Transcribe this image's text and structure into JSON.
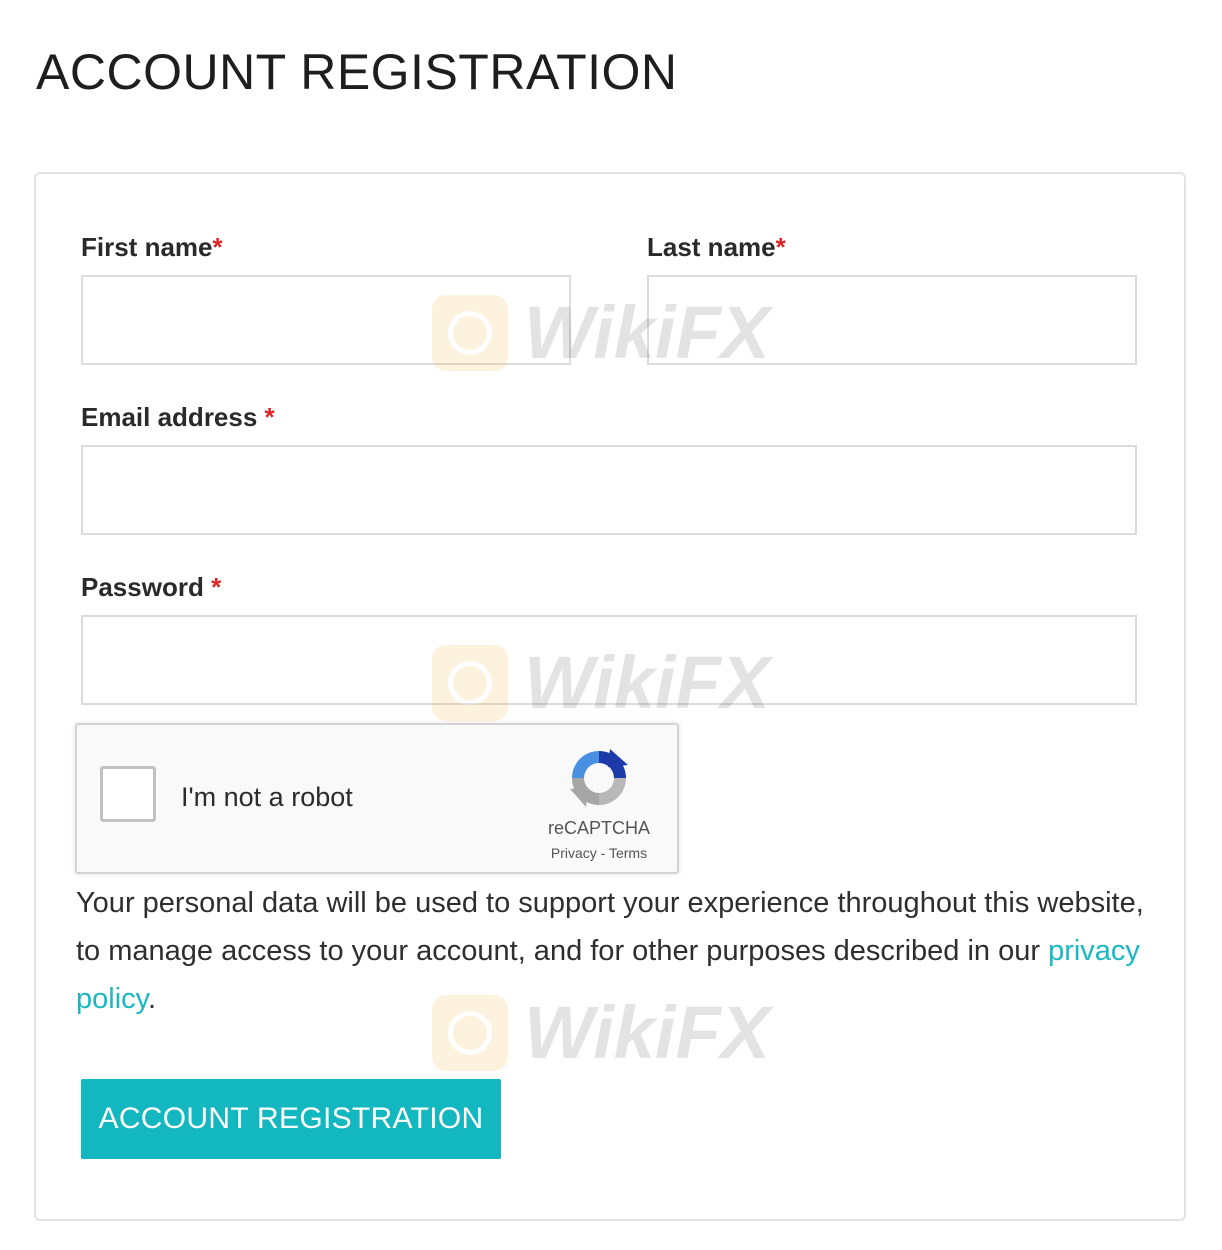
{
  "page": {
    "title": "ACCOUNT REGISTRATION"
  },
  "form": {
    "first_name": {
      "label": "First name",
      "required_mark": "*",
      "value": "",
      "placeholder": ""
    },
    "last_name": {
      "label": "Last name",
      "required_mark": "*",
      "value": "",
      "placeholder": ""
    },
    "email": {
      "label": "Email address",
      "required_mark": "*",
      "value": "",
      "placeholder": ""
    },
    "password": {
      "label": "Password",
      "required_mark": "*",
      "value": "",
      "placeholder": ""
    },
    "captcha": {
      "label": "I'm not a robot",
      "brand": "reCAPTCHA",
      "privacy_link": "Privacy",
      "separator": " - ",
      "terms_link": "Terms",
      "checked": false
    },
    "privacy_notice": {
      "text_before": "Your personal data will be used to support your experience throughout this website, to manage access to your account, and for other purposes described in our ",
      "link_text": "privacy policy",
      "text_after": "."
    },
    "submit_label": "ACCOUNT REGISTRATION"
  },
  "watermark": {
    "text": "WikiFX"
  },
  "colors": {
    "accent": "#12b7bf",
    "link": "#1ab8c2",
    "required": "#e02424",
    "card_border": "#e3e3e3",
    "input_border": "#dcdcdc"
  }
}
